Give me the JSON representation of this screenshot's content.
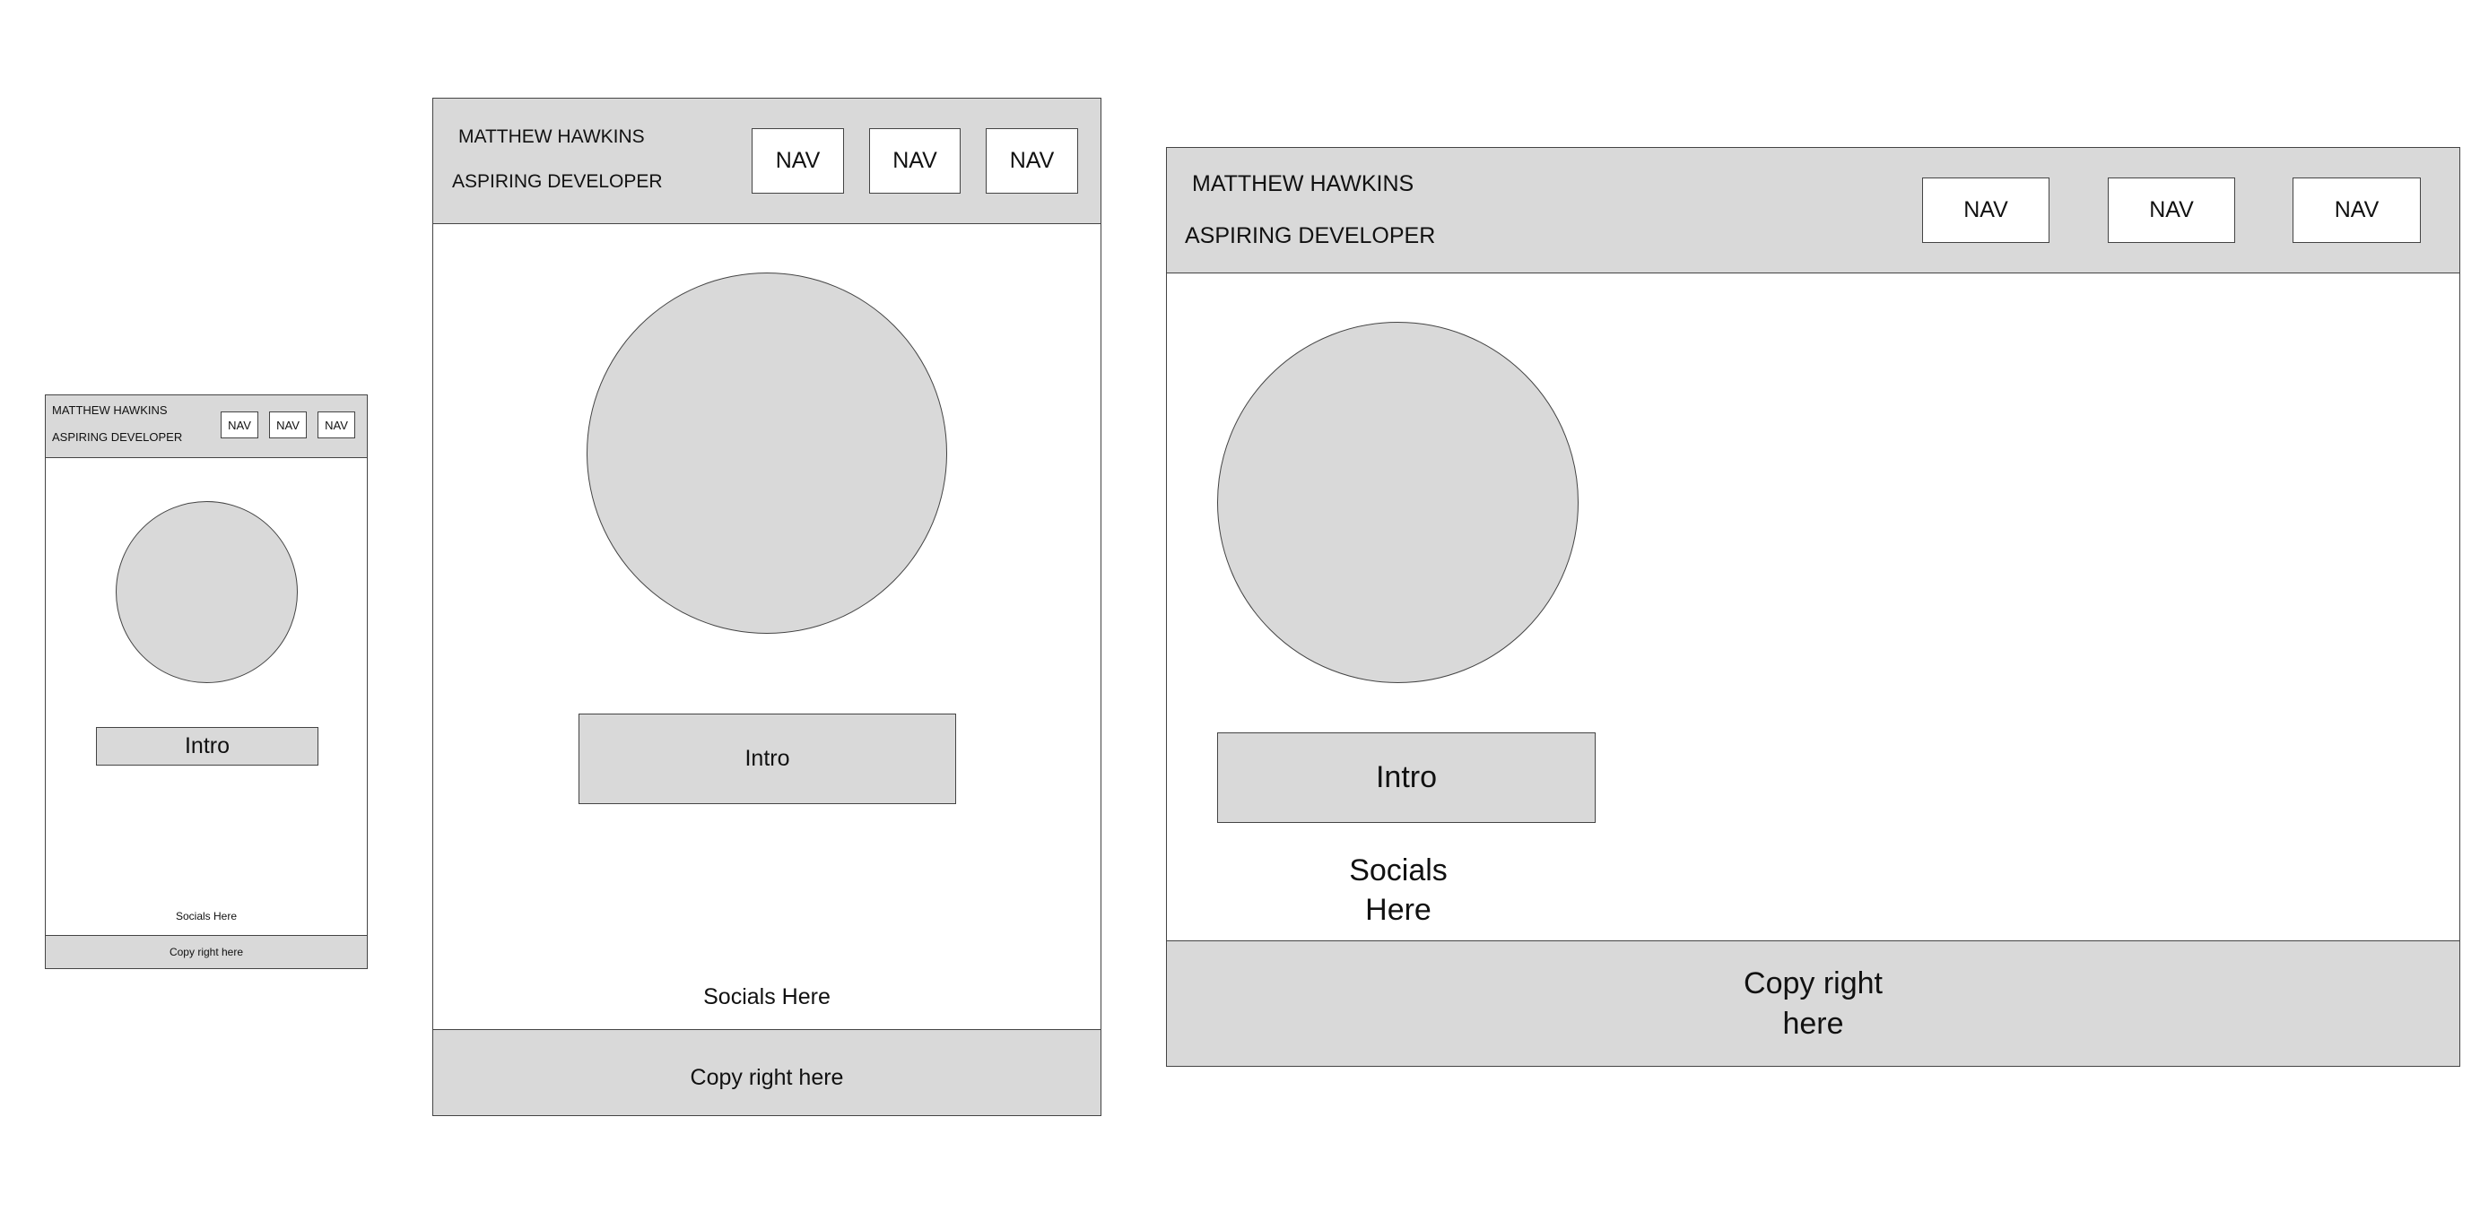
{
  "site": {
    "name": "MATTHEW HAWKINS",
    "tagline": "ASPIRING DEVELOPER",
    "nav": [
      "NAV",
      "NAV",
      "NAV"
    ],
    "intro": "Intro",
    "socials": "Socials Here",
    "copyright": "Copy right here"
  },
  "colors": {
    "fill": "#d9d9d9",
    "border": "#444444",
    "background": "#ffffff"
  }
}
